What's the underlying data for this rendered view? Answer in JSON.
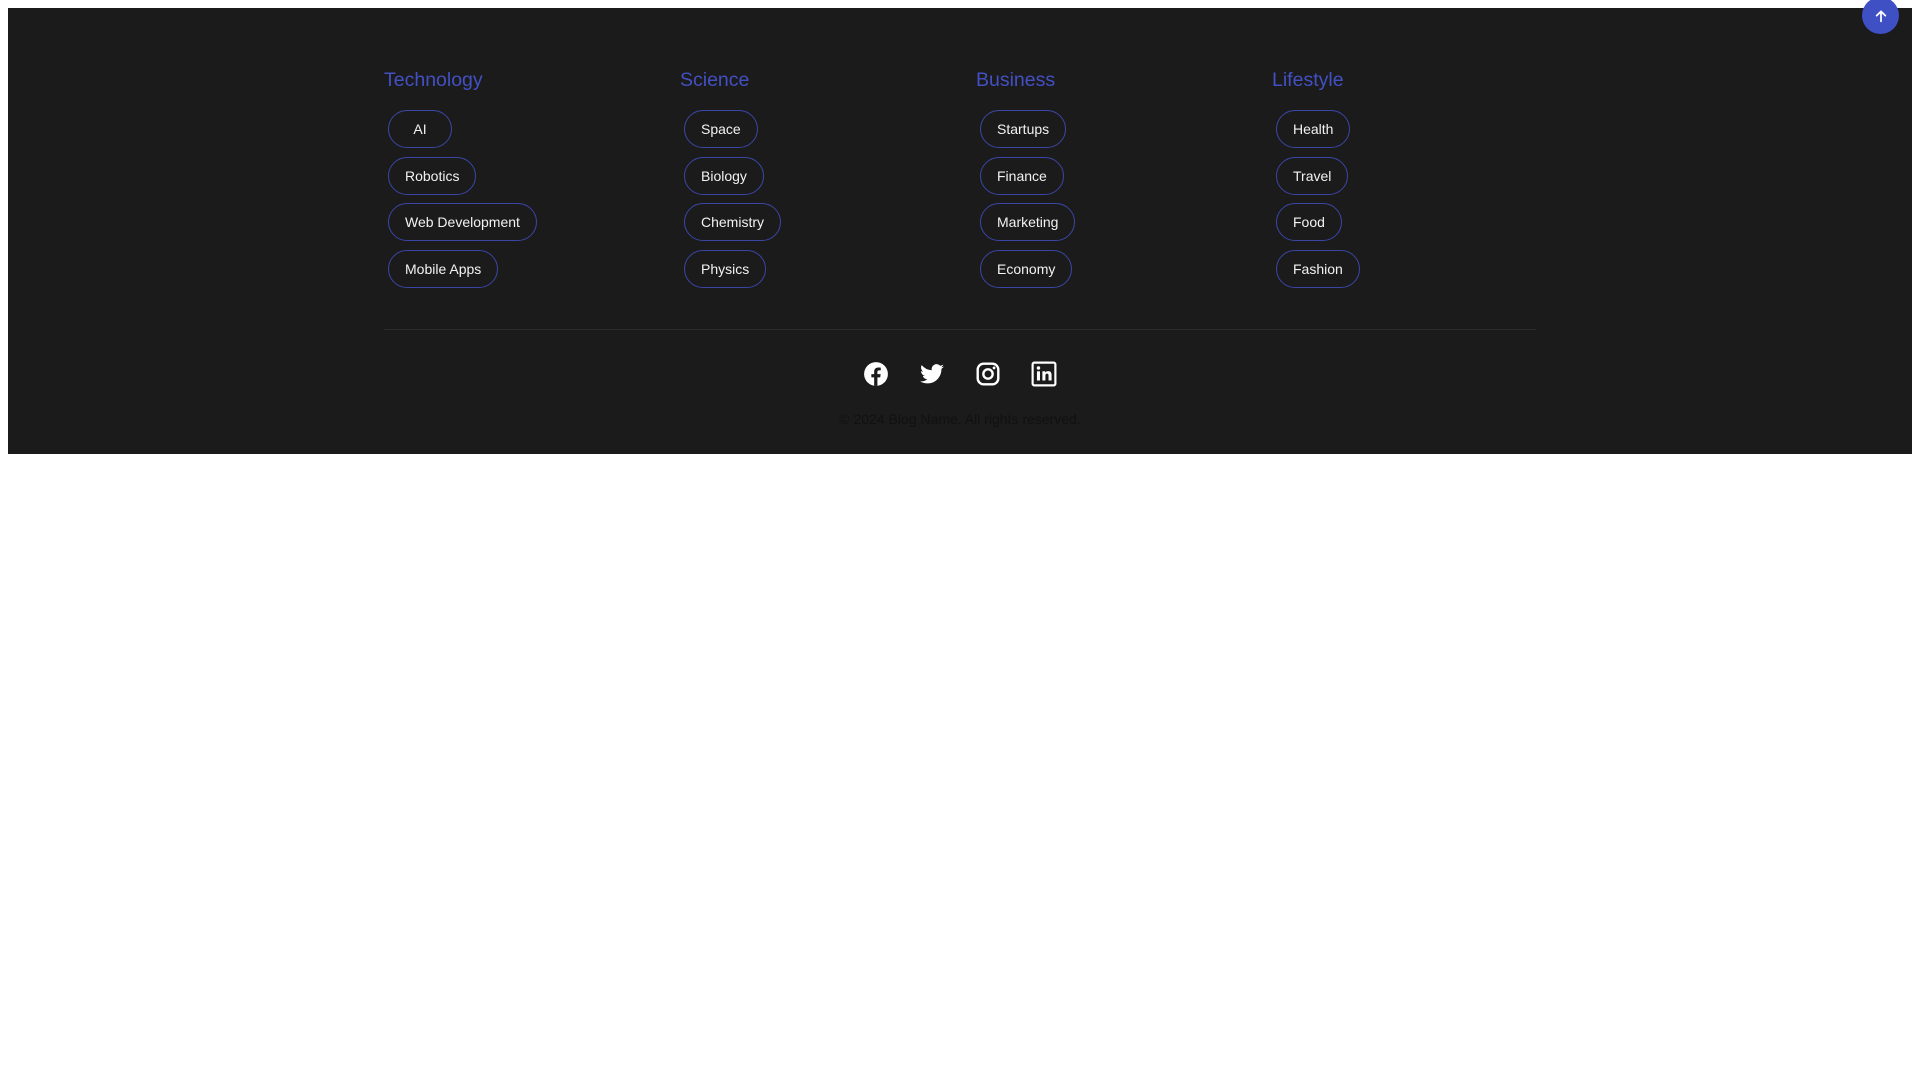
{
  "categories": [
    {
      "title": "Technology",
      "tags": [
        "AI",
        "Robotics",
        "Web Development",
        "Mobile Apps"
      ]
    },
    {
      "title": "Science",
      "tags": [
        "Space",
        "Biology",
        "Chemistry",
        "Physics"
      ]
    },
    {
      "title": "Business",
      "tags": [
        "Startups",
        "Finance",
        "Marketing",
        "Economy"
      ]
    },
    {
      "title": "Lifestyle",
      "tags": [
        "Health",
        "Travel",
        "Food",
        "Fashion"
      ]
    }
  ],
  "social": {
    "icons": [
      "facebook-icon",
      "twitter-icon",
      "instagram-icon",
      "linkedin-icon"
    ]
  },
  "footer": {
    "copyright": "© 2024 Blog Name. All rights reserved."
  },
  "colors": {
    "footer_bg": "#1b1b1b",
    "accent": "#4350c2",
    "tag_border": "#3a46a6",
    "tag_text": "#f2f2f2"
  }
}
